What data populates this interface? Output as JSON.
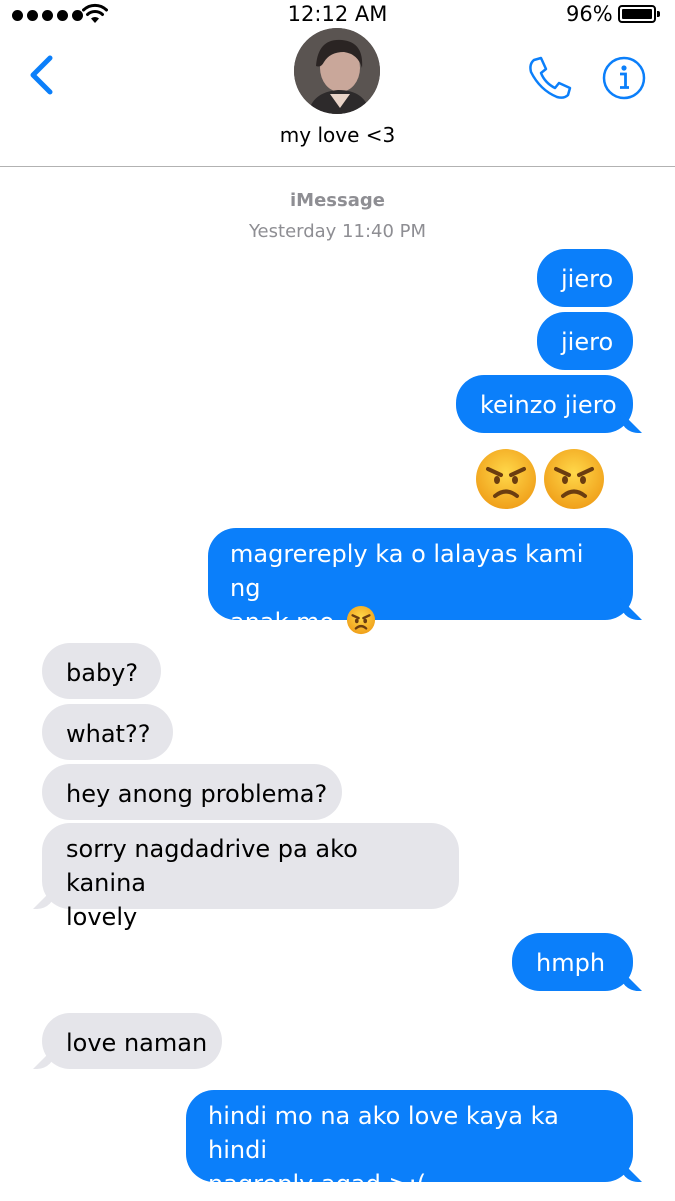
{
  "status_bar": {
    "time": "12:12 AM",
    "battery_percent": "96%",
    "signal_bars": 5,
    "icons": [
      "signal-dots-icon",
      "wifi-icon",
      "battery-icon"
    ]
  },
  "header": {
    "contact_name": "my love <3",
    "back_icon": "chevron-left-icon",
    "call_icon": "phone-icon",
    "info_icon": "info-icon",
    "accent_color": "#0b7ffa"
  },
  "thread": {
    "service_label": "iMessage",
    "timestamp": "Yesterday 11:40 PM",
    "sent_color": "#0b7ffa",
    "received_color": "#e5e5ea",
    "messages": [
      {
        "from": "me",
        "text": "jiero"
      },
      {
        "from": "me",
        "text": "jiero"
      },
      {
        "from": "me",
        "text": "keinzo jiero"
      },
      {
        "from": "me",
        "emoji": "angry-face x2"
      },
      {
        "from": "me",
        "text_line1": "magrereply ka o lalayas kami ng",
        "text_line2": "anak mo",
        "emoji": "angry-face"
      },
      {
        "from": "them",
        "text": "baby?"
      },
      {
        "from": "them",
        "text": "what??"
      },
      {
        "from": "them",
        "text": "hey anong problema?"
      },
      {
        "from": "them",
        "text_line1": "sorry nagdadrive pa ako kanina",
        "text_line2": "lovely"
      },
      {
        "from": "me",
        "text": "hmph"
      },
      {
        "from": "them",
        "text": "love naman"
      },
      {
        "from": "me",
        "text_line1": "hindi mo na ako love kaya ka hindi",
        "text_line2": "nagreply agad >:("
      }
    ]
  }
}
